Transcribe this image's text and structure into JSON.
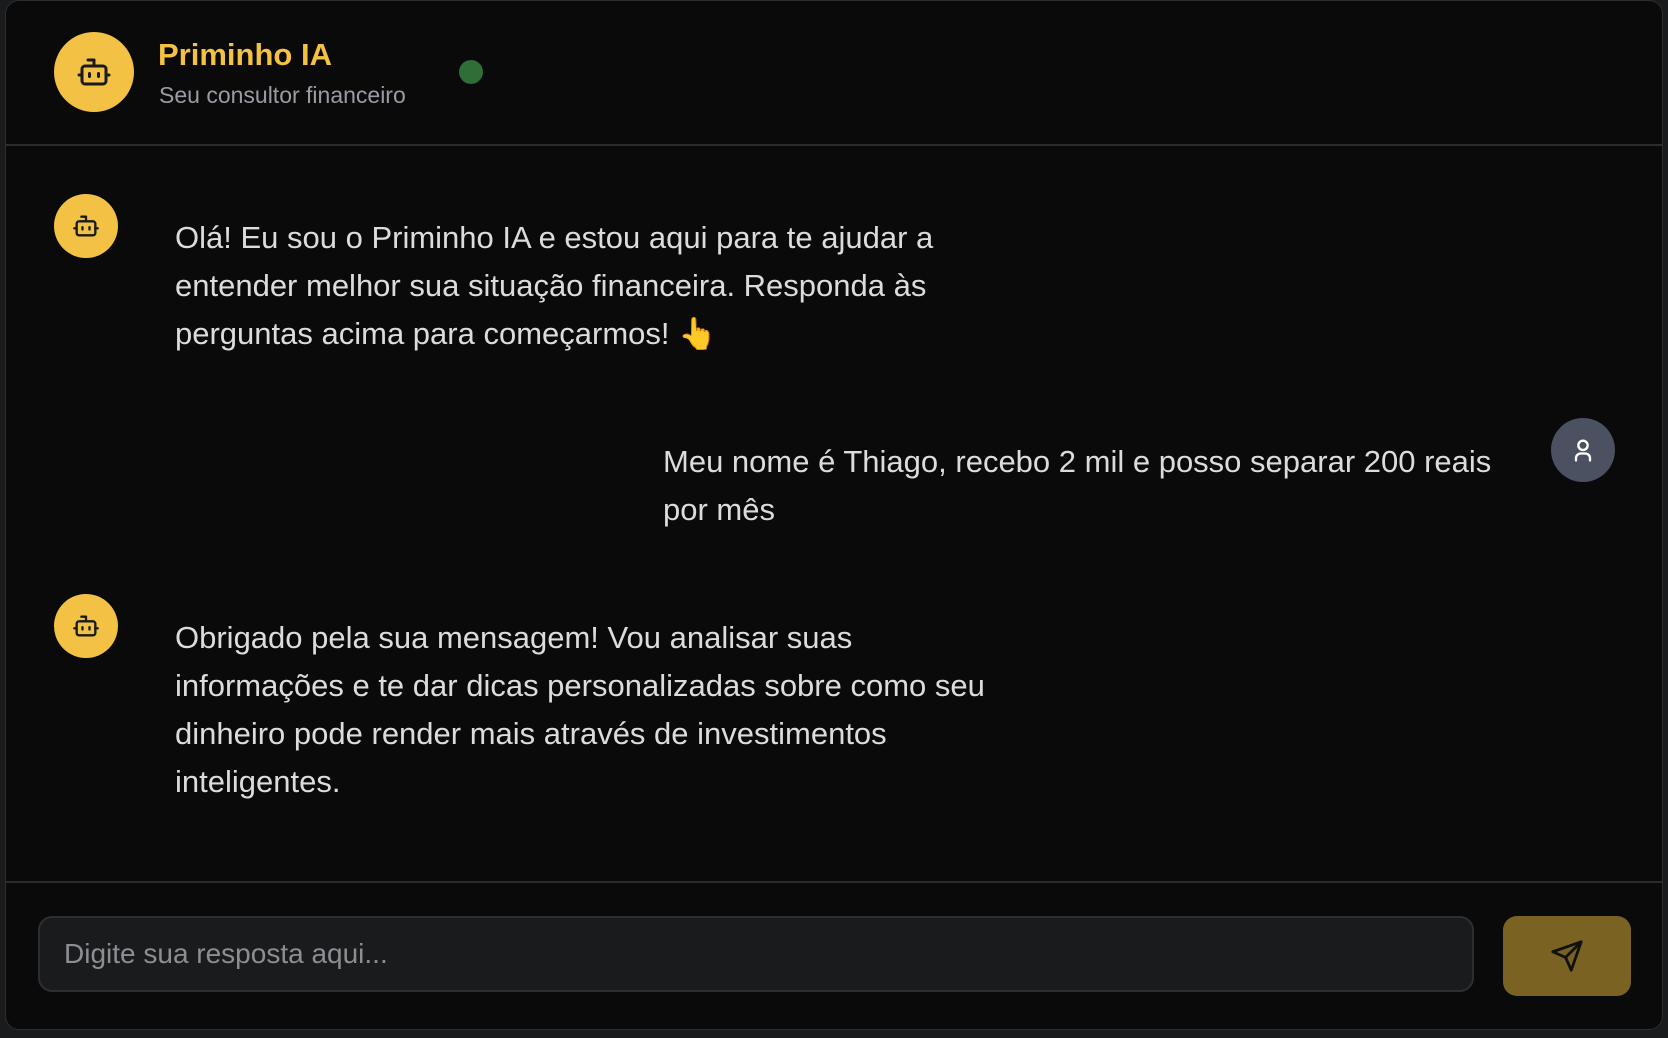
{
  "header": {
    "title": "Priminho IA",
    "subtitle": "Seu consultor financeiro",
    "avatar_icon": "robot-icon",
    "status": "online",
    "status_color": "#2f6e36"
  },
  "messages": [
    {
      "sender": "bot",
      "icon": "robot-icon",
      "text": "Olá! Eu sou o Priminho IA e estou aqui para te ajudar a entender melhor sua situação financeira. Responda às perguntas acima para começarmos! 👆"
    },
    {
      "sender": "user",
      "icon": "user-icon",
      "text": "Meu nome é Thiago, recebo 2 mil e posso separar 200 reais por mês"
    },
    {
      "sender": "bot",
      "icon": "robot-icon",
      "text": "Obrigado pela sua mensagem! Vou analisar suas informações e te dar dicas personalizadas sobre como seu dinheiro pode render mais através de investimentos inteligentes."
    }
  ],
  "composer": {
    "placeholder": "Digite sua resposta aqui...",
    "value": "",
    "send_icon": "send-icon"
  },
  "colors": {
    "accent": "#f3c244",
    "background": "#0a0a0b",
    "send_button": "#7a6322",
    "user_avatar": "#4b5160"
  }
}
